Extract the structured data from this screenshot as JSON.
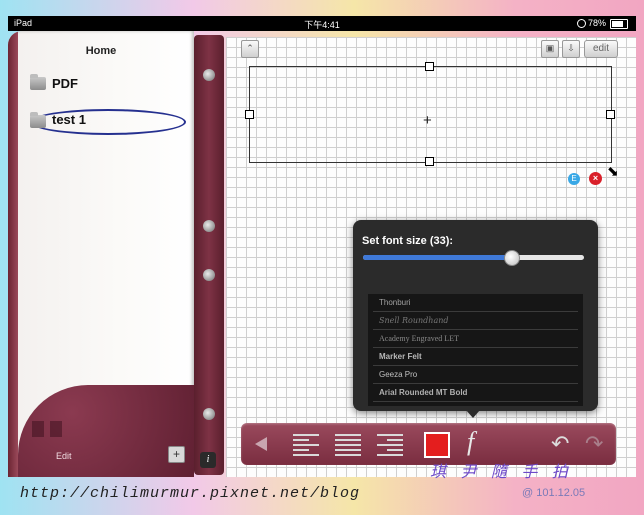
{
  "status_bar": {
    "device": "iPad",
    "time": "下午4:41",
    "battery": "78%"
  },
  "sidebar": {
    "title": "Home",
    "items": [
      {
        "label": "PDF",
        "icon": "folder-icon"
      },
      {
        "label": "test 1",
        "icon": "folder-icon"
      }
    ],
    "edit_label": "Edit",
    "add_label": "+"
  },
  "info_button": {
    "label": "i"
  },
  "canvas": {
    "edit_label": "edit",
    "badge_e": "E",
    "badge_close": "×"
  },
  "font_popup": {
    "title": "Set font size (33):",
    "font_size": 33,
    "slider_fraction": 0.67,
    "fonts": [
      "Thonburi",
      "Snell Roundhand",
      "Academy Engraved LET",
      "Marker Felt",
      "Geeza Pro",
      "Arial Rounded MT Bold"
    ]
  },
  "toolbar": {
    "fx_label": "f",
    "text_color": "#e41e1e"
  },
  "watermark": {
    "url": "http://chilimurmur.pixnet.net/blog",
    "signature": "琪 尹 隨 手 拍",
    "date": "@ 101.12.05"
  }
}
